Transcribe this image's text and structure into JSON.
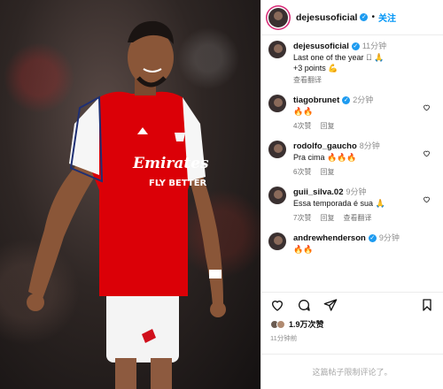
{
  "post": {
    "author": "dejesusoficial",
    "follow_label": "关注",
    "dot": "•"
  },
  "caption": {
    "user": "dejesusoficial",
    "time": "11分钟",
    "line1": "Last one of the year 🏽 🙏",
    "line2": "+3 points 💪",
    "translate": "查看翻译"
  },
  "comments": [
    {
      "user": "tiagobrunet",
      "verified": true,
      "time": "2分钟",
      "text": "🔥🔥",
      "likes": "4次赞",
      "reply": "回复",
      "translate": ""
    },
    {
      "user": "rodolfo_gaucho",
      "verified": false,
      "time": "8分钟",
      "text": "Pra cima 🔥🔥🔥",
      "likes": "6次赞",
      "reply": "回复",
      "translate": ""
    },
    {
      "user": "guii_silva.02",
      "verified": false,
      "time": "9分钟",
      "text": "Essa temporada é sua 🙏",
      "likes": "7次赞",
      "reply": "回复",
      "translate": "查看翻译"
    },
    {
      "user": "andrewhenderson",
      "verified": true,
      "time": "9分钟",
      "text": "🔥🔥",
      "likes": "",
      "reply": "",
      "translate": ""
    }
  ],
  "footer": {
    "likes": "1.9万次赞",
    "age": "11分钟前",
    "comments_closed": "这篇帖子限制评论了。"
  },
  "colors": {
    "accent": "#0095f6",
    "verified": "#1d9bf0"
  },
  "photo": {
    "shirt_sponsor_1": "Emirates",
    "shirt_sponsor_2": "FLY BETTER"
  }
}
